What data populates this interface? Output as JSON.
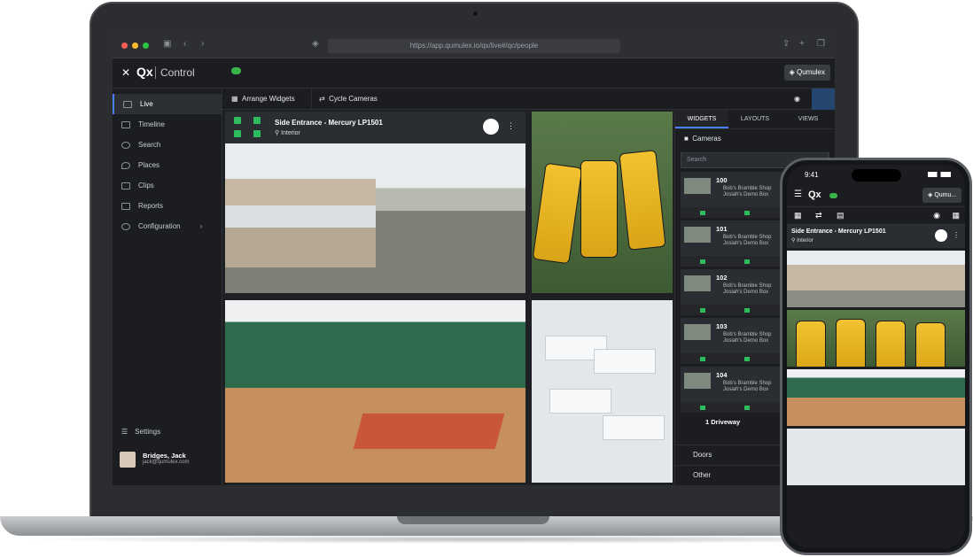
{
  "browser": {
    "url": "https://app.qumulex.io/qx/live#/qc/people"
  },
  "app": {
    "close": "✕",
    "logo": "Qx",
    "name": "Control",
    "account_button": "Qumulex"
  },
  "sidebar": {
    "items": [
      {
        "label": "Live"
      },
      {
        "label": "Timeline"
      },
      {
        "label": "Search"
      },
      {
        "label": "Places"
      },
      {
        "label": "Clips"
      },
      {
        "label": "Reports"
      },
      {
        "label": "Configuration"
      }
    ],
    "settings": "Settings",
    "user_name": "Bridges, Jack",
    "user_email": "jack@qumulex.com"
  },
  "toolbar": {
    "arrange": "Arrange Widgets",
    "cycle": "Cycle Cameras"
  },
  "video": {
    "title": "Side Entrance - Mercury LP1501",
    "subtitle": "Interior"
  },
  "panel": {
    "tabs": [
      "WIDGETS",
      "LAYOUTS",
      "VIEWS"
    ],
    "section": "Cameras",
    "search_placeholder": "Search",
    "cameras": [
      {
        "id": "100",
        "line1": "Bob's Bramble Shop",
        "line2": "Josiah's Demo Box"
      },
      {
        "id": "101",
        "line1": "Bob's Bramble Shop",
        "line2": "Josiah's Demo Box"
      },
      {
        "id": "102",
        "line1": "Bob's Bramble Shop",
        "line2": "Josiah's Demo Box"
      },
      {
        "id": "103",
        "line1": "Bob's Bramble Shop",
        "line2": "Josiah's Demo Box"
      },
      {
        "id": "104",
        "line1": "Bob's Bramble Shop",
        "line2": "Josiah's Demo Box"
      }
    ],
    "driveway": "1 Driveway",
    "doors": "Doors",
    "other": "Other"
  },
  "phone": {
    "time": "9:41",
    "logo": "Qx",
    "account_button": "Qumu...",
    "video_title": "Side Entrance - Mercury LP1501",
    "video_subtitle": "Interior"
  }
}
